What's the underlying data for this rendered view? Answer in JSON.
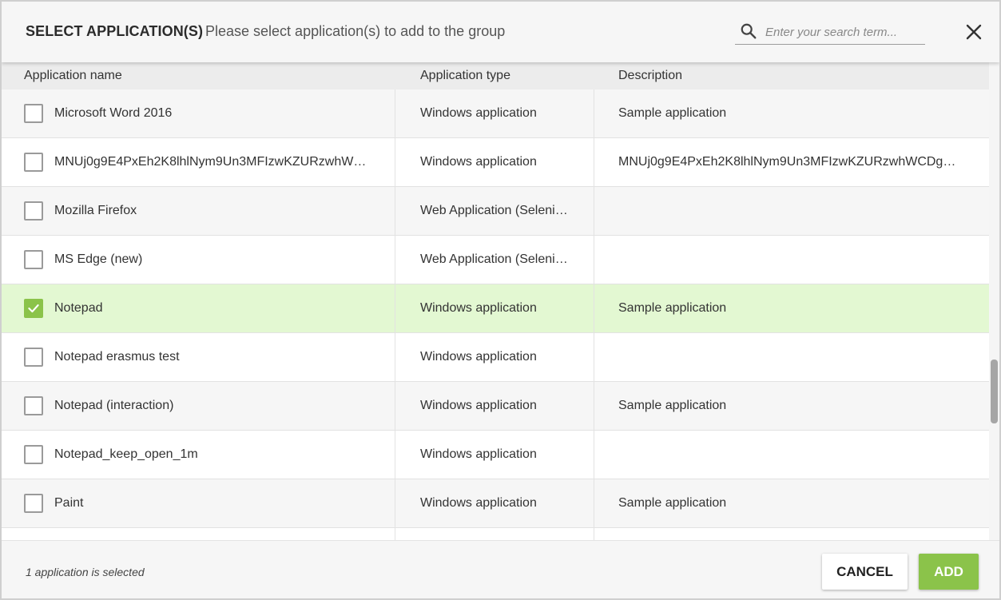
{
  "header": {
    "title": "SELECT APPLICATION(S)",
    "subtitle": "Please select application(s) to add to the group",
    "search_placeholder": "Enter your search term...",
    "search_icon": "search-icon",
    "close_icon": "close-icon"
  },
  "table": {
    "columns": [
      "Application name",
      "Application type",
      "Description"
    ],
    "rows": [
      {
        "name": "Microsoft Word 2016",
        "type": "Windows application",
        "description": "Sample application",
        "checked": false
      },
      {
        "name": "MNUj0g9E4PxEh2K8lhlNym9Un3MFIzwKZURzwhWC…",
        "type": "Windows application",
        "description": "MNUj0g9E4PxEh2K8lhlNym9Un3MFIzwKZURzwhWCDgM…",
        "checked": false
      },
      {
        "name": "Mozilla Firefox",
        "type": "Web Application (Seleni…",
        "description": "",
        "checked": false
      },
      {
        "name": "MS Edge (new)",
        "type": "Web Application (Seleni…",
        "description": "",
        "checked": false
      },
      {
        "name": "Notepad",
        "type": "Windows application",
        "description": "Sample application",
        "checked": true
      },
      {
        "name": "Notepad erasmus test",
        "type": "Windows application",
        "description": "",
        "checked": false
      },
      {
        "name": "Notepad (interaction)",
        "type": "Windows application",
        "description": "Sample application",
        "checked": false
      },
      {
        "name": "Notepad_keep_open_1m",
        "type": "Windows application",
        "description": "",
        "checked": false
      },
      {
        "name": "Paint",
        "type": "Windows application",
        "description": "Sample application",
        "checked": false
      },
      {
        "name": "",
        "type": "",
        "description": "",
        "checked": false
      }
    ]
  },
  "footer": {
    "status": "1 application is selected",
    "cancel_label": "CANCEL",
    "add_label": "ADD"
  },
  "colors": {
    "accent_green": "#8bc34a",
    "selected_row": "#e3f8d2",
    "header_bg": "#f6f6f6"
  }
}
